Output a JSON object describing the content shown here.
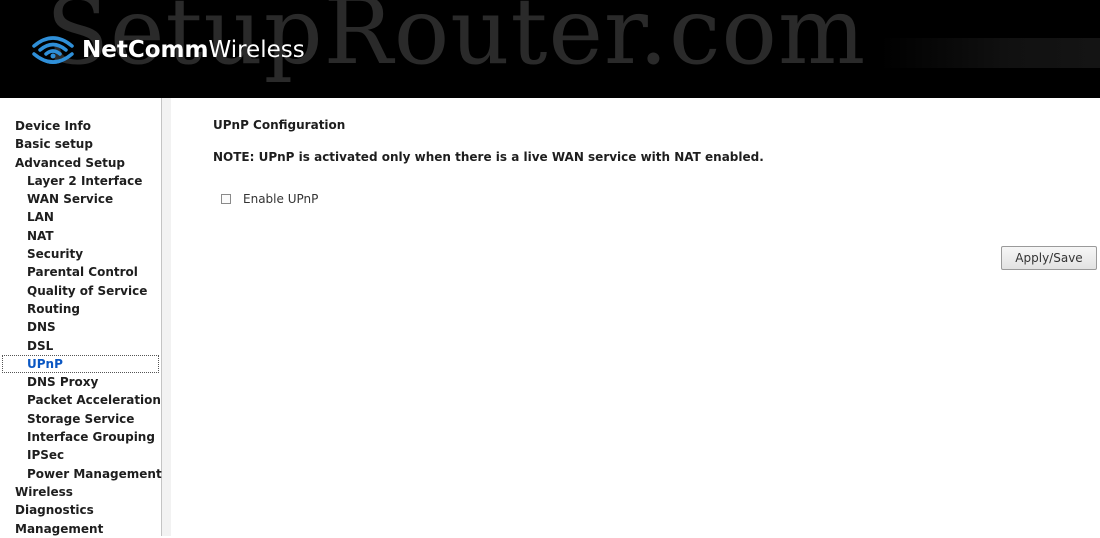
{
  "header": {
    "watermark": "SetupRouter.com",
    "logo_bold": "NetComm",
    "logo_light": "Wireless",
    "icon": "wifi-signal-icon"
  },
  "sidebar": {
    "items": [
      {
        "label": "Device Info",
        "level": "top"
      },
      {
        "label": "Basic setup",
        "level": "top"
      },
      {
        "label": "Advanced Setup",
        "level": "top"
      },
      {
        "label": "Layer 2 Interface",
        "level": "sub"
      },
      {
        "label": "WAN Service",
        "level": "sub"
      },
      {
        "label": "LAN",
        "level": "sub"
      },
      {
        "label": "NAT",
        "level": "sub"
      },
      {
        "label": "Security",
        "level": "sub"
      },
      {
        "label": "Parental Control",
        "level": "sub"
      },
      {
        "label": "Quality of Service",
        "level": "sub"
      },
      {
        "label": "Routing",
        "level": "sub"
      },
      {
        "label": "DNS",
        "level": "sub"
      },
      {
        "label": "DSL",
        "level": "sub"
      },
      {
        "label": "UPnP",
        "level": "sub",
        "active": true
      },
      {
        "label": "DNS Proxy",
        "level": "sub"
      },
      {
        "label": "Packet Acceleration",
        "level": "sub"
      },
      {
        "label": "Storage Service",
        "level": "sub"
      },
      {
        "label": "Interface Grouping",
        "level": "sub"
      },
      {
        "label": "IPSec",
        "level": "sub"
      },
      {
        "label": "Power Management",
        "level": "sub"
      },
      {
        "label": "Wireless",
        "level": "top"
      },
      {
        "label": "Diagnostics",
        "level": "top"
      },
      {
        "label": "Management",
        "level": "top"
      }
    ]
  },
  "main": {
    "title": "UPnP Configuration",
    "note": "NOTE: UPnP is activated only when there is a live WAN service with NAT enabled.",
    "enable_label": "Enable UPnP",
    "enable_checked": false,
    "apply_label": "Apply/Save"
  },
  "colors": {
    "header_bg": "#000000",
    "active_link": "#0b57c3"
  }
}
